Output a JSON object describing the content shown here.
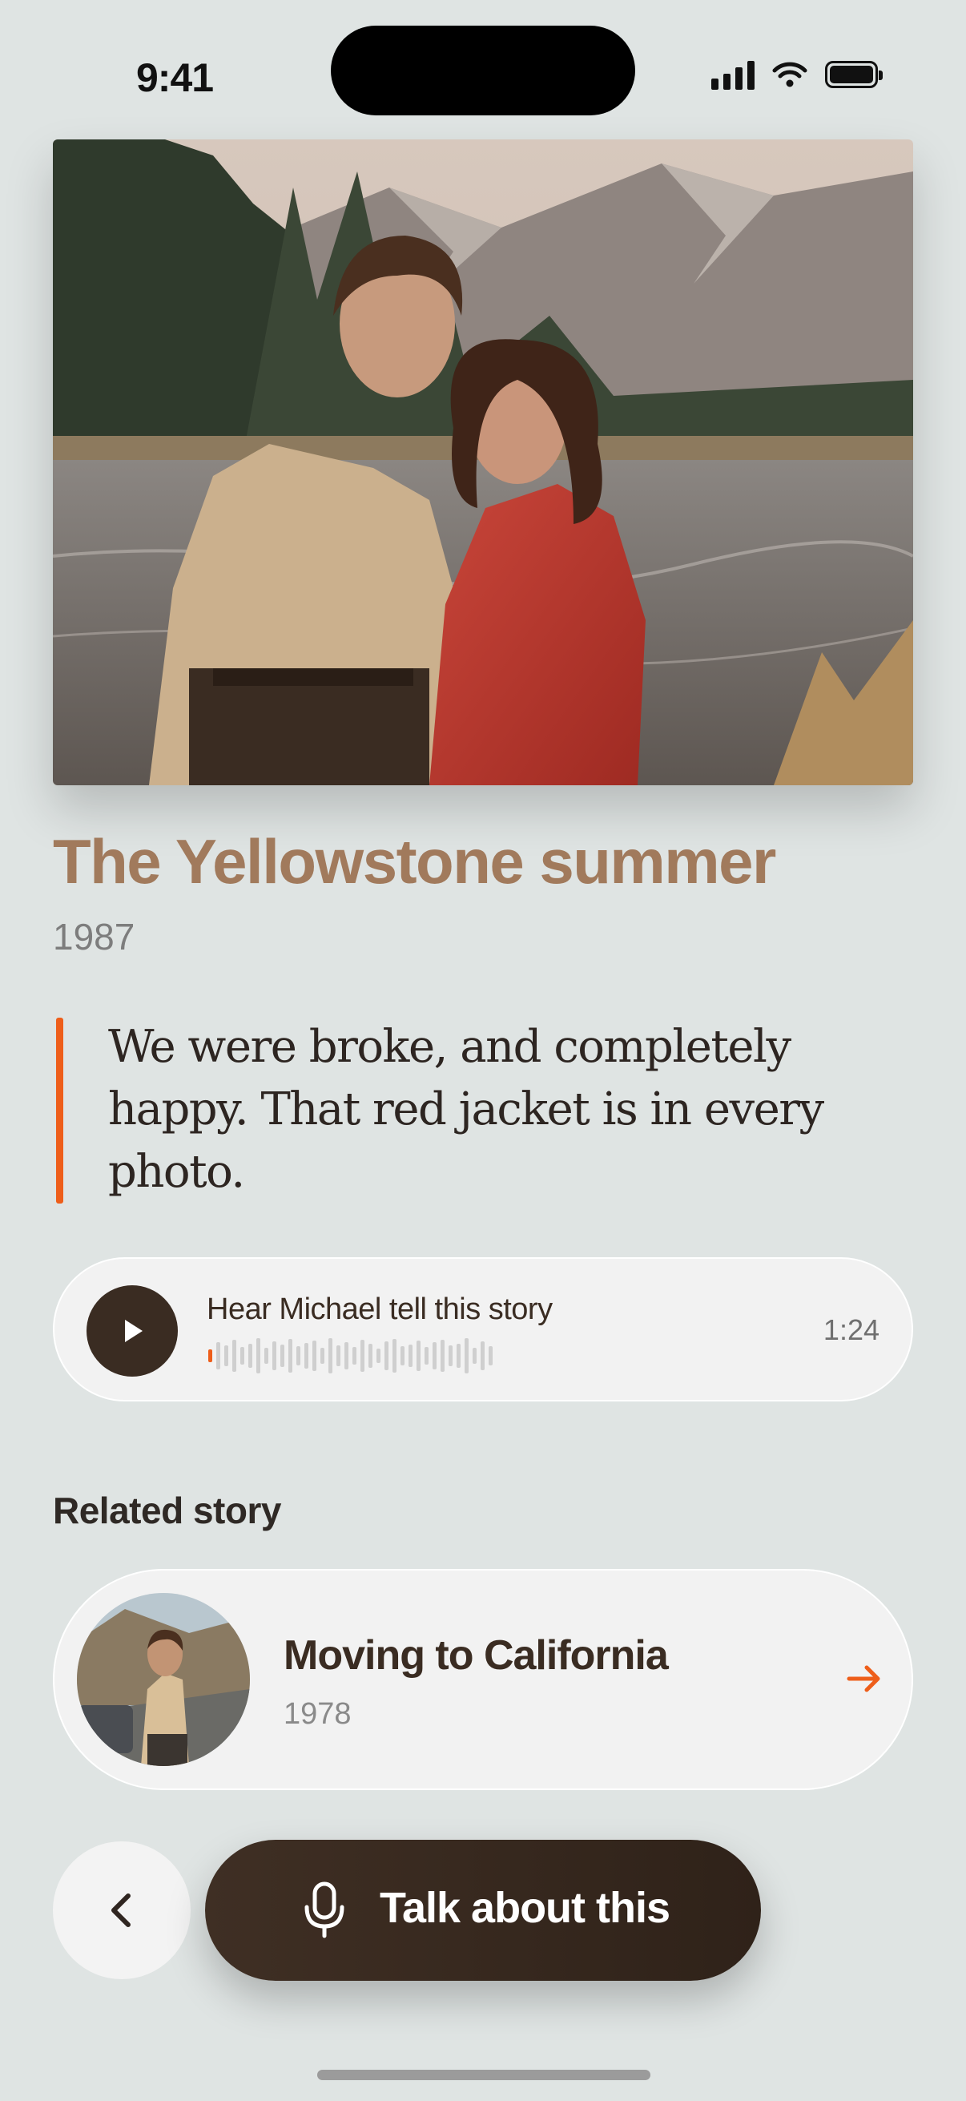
{
  "status_bar": {
    "time": "9:41"
  },
  "memory": {
    "title": "The Yellowstone summer",
    "year": "1987",
    "quote": "We were broke, and completely happy. That red jacket is in every photo."
  },
  "audio": {
    "label": "Hear Michael tell this story",
    "duration": "1:24",
    "progress": 0.01
  },
  "related": {
    "heading": "Related story",
    "title": "Moving to California",
    "year": "1978"
  },
  "actions": {
    "talk_label": "Talk about this"
  },
  "colors": {
    "accent": "#ee5e1a",
    "title": "#a17a5c",
    "dark_brown": "#3a2c22",
    "background": "#dfe4e3"
  },
  "icons": [
    "signal-icon",
    "wifi-icon",
    "battery-icon",
    "play-icon",
    "arrow-right-icon",
    "chevron-left-icon",
    "microphone-icon"
  ]
}
